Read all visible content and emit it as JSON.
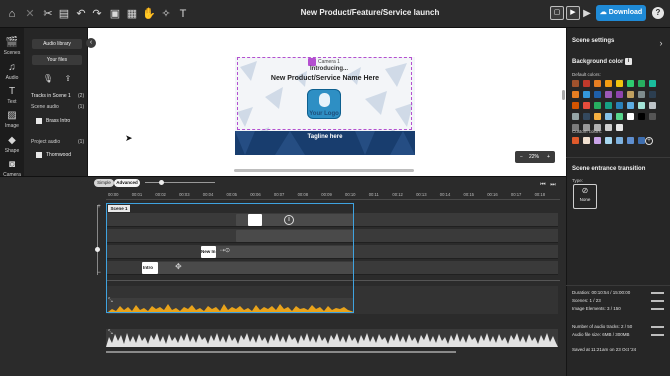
{
  "topbar": {
    "title": "New Product/Feature/Service launch",
    "download_label": "Download",
    "help": "?",
    "left_icons": [
      "home-icon",
      "close-icon",
      "cut-icon",
      "clipboard-icon",
      "undo-icon",
      "redo-icon",
      "media-library-icon",
      "grid-icon",
      "hand-icon",
      "magic-icon",
      "text-tool-icon"
    ],
    "right_icons": [
      "preview-frame-icon",
      "play-scene-icon",
      "play-all-icon"
    ]
  },
  "rail": {
    "items": [
      {
        "icon": "scenes-icon",
        "label": "Scenes"
      },
      {
        "icon": "audio-icon",
        "label": "Audio"
      },
      {
        "icon": "text-icon",
        "label": "Text"
      },
      {
        "icon": "image-icon",
        "label": "Image"
      },
      {
        "icon": "shape-icon",
        "label": "Shape"
      },
      {
        "icon": "camera-icon",
        "label": "Camera"
      }
    ]
  },
  "audio_panel": {
    "library_btn": "Audio library",
    "your_files_btn": "Your files",
    "tracks_heading": "Tracks in Scene 1",
    "tracks_count": "(2)",
    "scene_audio_label": "Scene audio",
    "scene_audio_count": "(1)",
    "scene_audio_item": "Brass Intro",
    "project_audio_label": "Project audio",
    "project_audio_count": "(1)",
    "project_audio_item": "Thornwood"
  },
  "canvas": {
    "camera_label": "Camera 1",
    "intro_text": "Introducing...",
    "headline": "New Product/Service Name Here",
    "logo_text": "Your Logo",
    "tagline": "Tagline here",
    "zoom_minus": "−",
    "zoom_value": "22%",
    "zoom_plus": "+",
    "collapse": "‹"
  },
  "right_panel": {
    "heading": "Scene settings",
    "bg_heading": "Background color",
    "default_colors_label": "Default colors:",
    "custom_colors_label": "Custom colors:",
    "transition_heading": "Scene entrance transition",
    "type_label": "Type:",
    "transition_value": "None",
    "default_colors": [
      "#a0522d",
      "#c0392b",
      "#e67e22",
      "#f39c12",
      "#f1c40f",
      "#2ecc71",
      "#27ae60",
      "#1abc9c",
      "#e67e22",
      "#3498db",
      "#1f5fa8",
      "#9b59b6",
      "#8e44ad",
      "#c0a060",
      "#7f8c8d",
      "#2c3e50",
      "#d35400",
      "#e74c3c",
      "#27ae60",
      "#16a085",
      "#2980b9",
      "#5dade2",
      "#a3e4d7",
      "#bdc3c7",
      "#95a5a6",
      "#34495e",
      "#f5b041",
      "#85c1e9",
      "#58d68d",
      "#ffffff",
      "#000000",
      "#555555",
      "#7b7b7b",
      "#999999",
      "#b0b0b0",
      "#d0d0d0",
      "#e8e8e8"
    ],
    "custom_colors": [
      "#e05a2b",
      "#f0e0d0",
      "#c9a3e8",
      "#a8d8f0",
      "#7fb3e0",
      "#5f8fd0",
      "#3f6fb0"
    ],
    "stats": {
      "duration": "Duration: 00:10:54 / 15:00:00",
      "scenes": "Scenes: 1 / 23",
      "image_elements": "Image Elements: 3 / 150",
      "audio_tracks": "Number of audio tracks: 2 / 50",
      "audio_size": "Audio file size: 6MB / 300MB",
      "saved": "Saved at 11:21am on 23 Oct '24"
    }
  },
  "timeline": {
    "simple_label": "Simple",
    "advanced_label": "Advanced",
    "scene_tag": "Scene 1",
    "ruler": [
      "00:00",
      "00:01",
      "00:02",
      "00:03",
      "00:04",
      "00:05",
      "00:06",
      "00:07",
      "00:08",
      "00:09",
      "00:10",
      "00:11",
      "00:12",
      "00:13",
      "00:14",
      "00:15",
      "00:16",
      "00:17",
      "00:18"
    ],
    "clip_new_label": "New In",
    "clip_intro_label": "Intro"
  }
}
